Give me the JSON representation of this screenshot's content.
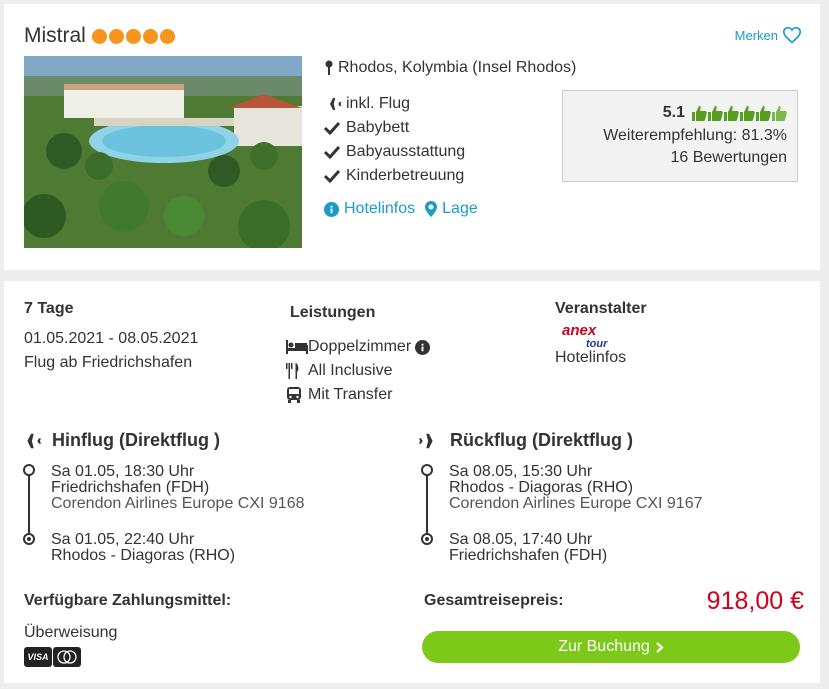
{
  "hotel": {
    "name": "Mistral",
    "stars": 5,
    "star_color": "#f7941d",
    "bookmark_label": "Merken",
    "location": "Rhodos, Kolymbia (Insel Rhodos)",
    "features": [
      "inkl. Flug",
      "Babybett",
      "Babyausstattung",
      "Kinderbetreuung"
    ],
    "links": [
      "Hotelinfos",
      "Lage"
    ],
    "rating": {
      "score": "5.1",
      "thumbs": 6,
      "recommendation": "Weiterempfehlung: 81.3%",
      "reviews": "16 Bewertungen"
    }
  },
  "offer": {
    "duration": "7 Tage",
    "dates": "01.05.2021 - 08.05.2021",
    "departure": "Flug ab Friedrichshafen",
    "services_title": "Leistungen",
    "services": [
      "Doppelzimmer",
      "All Inclusive",
      "Mit Transfer"
    ],
    "operator_title": "Veranstalter",
    "operator_logo_text": "anex tour",
    "operator_link": "Hotelinfos",
    "outbound": {
      "title": "Hinflug (Direktflug )",
      "dep_time": "Sa 01.05, 18:30 Uhr",
      "dep_airport": "Friedrichshafen (FDH)",
      "airline": "Corendon Airlines Europe CXI 9168",
      "arr_time": "Sa 01.05, 22:40 Uhr",
      "arr_airport": "Rhodos - Diagoras (RHO)"
    },
    "return": {
      "title": "Rückflug (Direktflug )",
      "dep_time": "Sa 08.05, 15:30 Uhr",
      "dep_airport": "Rhodos - Diagoras (RHO)",
      "airline": "Corendon Airlines Europe CXI 9167",
      "arr_time": "Sa 08.05, 17:40 Uhr",
      "arr_airport": "Friedrichshafen (FDH)"
    },
    "payment_title": "Verfügbare Zahlungsmittel:",
    "payment_method": "Überweisung",
    "payment_cards": [
      "VISA",
      "Mastercard"
    ],
    "total_label": "Gesamtreisepreis:",
    "total_price": "918,00 €",
    "book_button": "Zur Buchung"
  },
  "colors": {
    "accent": "#1a9bc9",
    "price": "#d0021b",
    "button": "#7cc91a",
    "stars": "#f7941d",
    "thumbs": "#5a9e1f"
  }
}
